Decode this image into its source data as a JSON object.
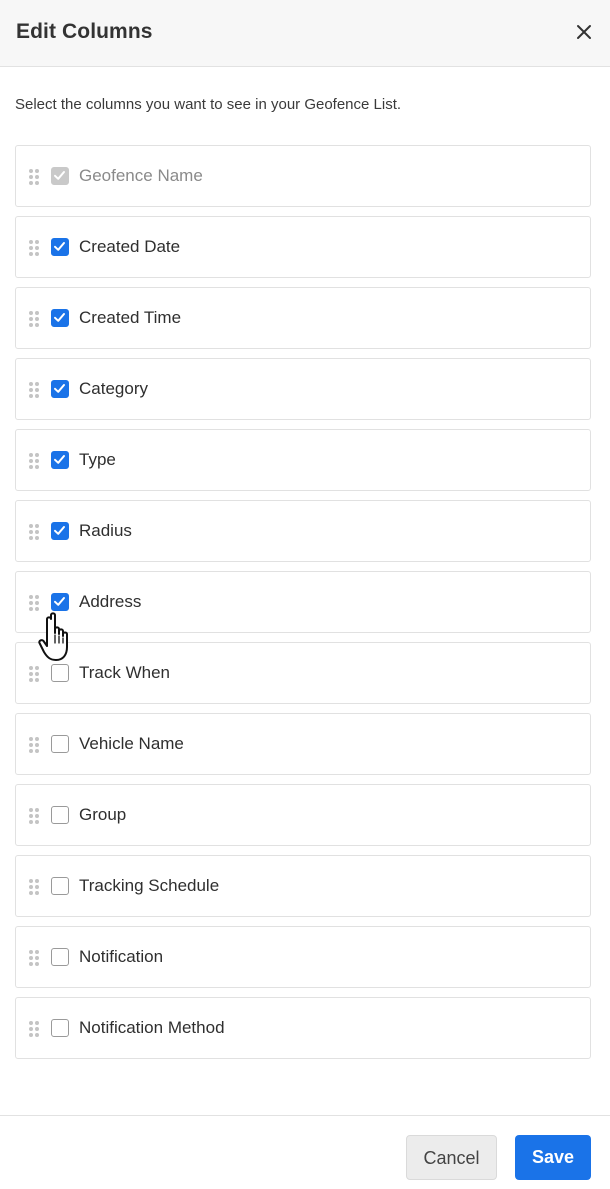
{
  "dialog": {
    "title": "Edit Columns",
    "close_icon": "close-icon",
    "subtitle": "Select the columns you want to see in your Geofence List."
  },
  "columns": [
    {
      "label": "Geofence Name",
      "checked": true,
      "disabled": true
    },
    {
      "label": "Created Date",
      "checked": true,
      "disabled": false
    },
    {
      "label": "Created Time",
      "checked": true,
      "disabled": false
    },
    {
      "label": "Category",
      "checked": true,
      "disabled": false
    },
    {
      "label": "Type",
      "checked": true,
      "disabled": false
    },
    {
      "label": "Radius",
      "checked": true,
      "disabled": false
    },
    {
      "label": "Address",
      "checked": true,
      "disabled": false
    },
    {
      "label": "Track When",
      "checked": false,
      "disabled": false
    },
    {
      "label": "Vehicle Name",
      "checked": false,
      "disabled": false
    },
    {
      "label": "Group",
      "checked": false,
      "disabled": false
    },
    {
      "label": "Tracking Schedule",
      "checked": false,
      "disabled": false
    },
    {
      "label": "Notification",
      "checked": false,
      "disabled": false
    },
    {
      "label": "Notification Method",
      "checked": false,
      "disabled": false
    }
  ],
  "footer": {
    "cancel_label": "Cancel",
    "save_label": "Save"
  },
  "colors": {
    "accent": "#1a73e8",
    "disabled_check": "#c9c9c9"
  }
}
